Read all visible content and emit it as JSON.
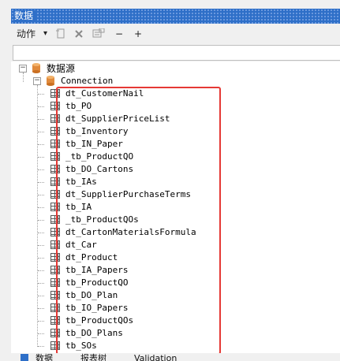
{
  "panel": {
    "title": "数据"
  },
  "toolbar": {
    "actions_label": "动作",
    "actions_arrow": "▾",
    "minus": "−",
    "plus": "+"
  },
  "tree": {
    "root_label": "数据源",
    "connection_label": "Connection",
    "items": [
      "dt_CustomerNail",
      "tb_PO",
      "dt_SupplierPriceList",
      "tb_Inventory",
      "tb_IN_Paper",
      "_tb_ProductQO",
      "tb_DO_Cartons",
      "tb_IAs",
      "dt_SupplierPurchaseTerms",
      "tb_IA",
      "_tb_ProductQOs",
      "dt_CartonMaterialsFormula",
      "dt_Car",
      "dt_Product",
      "tb_IA_Papers",
      "tb_ProductQO",
      "tb_DO_Plan",
      "tb_IO_Papers",
      "tb_ProductQOs",
      "tb_DO_Plans",
      "tb_SOs"
    ]
  },
  "bottom_tabs": [
    "数据",
    "报表树",
    "Validation"
  ],
  "colors": {
    "title_bg": "#2e6fc8",
    "highlight": "#e53935",
    "db_icon": "#e08a3c"
  }
}
